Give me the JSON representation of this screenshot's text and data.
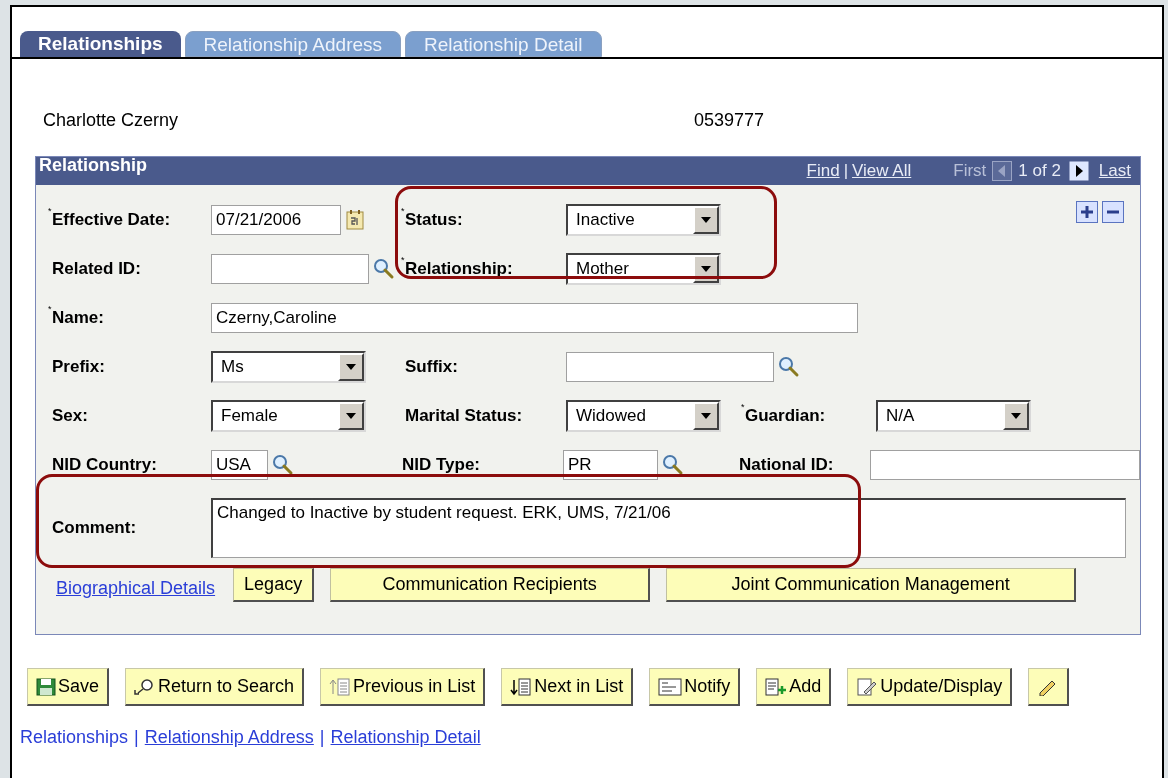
{
  "tabs": [
    {
      "label": "Relationships",
      "selected": true
    },
    {
      "label": "Relationship Address",
      "selected": false
    },
    {
      "label": "Relationship Detail",
      "selected": false
    }
  ],
  "required_mark": "*",
  "person": {
    "name": "Charlotte Czerny",
    "id": "0539777"
  },
  "panel": {
    "title": "Relationship",
    "find": "Find",
    "separator": "|",
    "view_all": "View All",
    "first": "First",
    "count": "1 of 2",
    "last": "Last",
    "first_disabled": true,
    "rows": [
      [
        {
          "label": "Effective Date:",
          "required": true,
          "kind": "date",
          "value": "07/21/2006"
        },
        {
          "label": "Status:",
          "required": true,
          "kind": "select",
          "value": "Inactive"
        }
      ],
      [
        {
          "label": "Related ID:",
          "required": false,
          "kind": "lookup"
        },
        {
          "label": "Relationship:",
          "required": true,
          "kind": "select",
          "value": "Mother"
        }
      ],
      [
        {
          "label": "Name:",
          "required": true,
          "kind": "text",
          "value": "Czerny,Caroline"
        }
      ],
      [
        {
          "label": "Prefix:",
          "required": false,
          "kind": "select",
          "value": "Ms"
        },
        {
          "label": "Suffix:",
          "required": false,
          "kind": "lookup"
        }
      ],
      [
        {
          "label": "Sex:",
          "required": false,
          "kind": "select",
          "value": "Female"
        },
        {
          "label": "Marital Status:",
          "required": false,
          "kind": "select",
          "value": "Widowed"
        },
        {
          "label": "Guardian:",
          "required": true,
          "kind": "select",
          "value": "N/A"
        }
      ],
      [
        {
          "label": "NID Country:",
          "required": false,
          "kind": "lookup",
          "value": "USA"
        },
        {
          "label": "NID Type:",
          "required": false,
          "kind": "lookup",
          "value": "PR"
        },
        {
          "label": "National ID:",
          "required": false,
          "kind": "text"
        }
      ],
      [
        {
          "label": "Comment:",
          "required": false,
          "kind": "textarea",
          "value": "Changed to Inactive by student request. ERK, UMS, 7/21/06"
        }
      ]
    ],
    "link": "Biographical Details",
    "buttons": [
      "Legacy",
      "Communication Recipients",
      "Joint Communication Management"
    ]
  },
  "toolbar": [
    {
      "kind": "labeled",
      "label": "Save"
    },
    {
      "kind": "labeled",
      "label": "Return to Search"
    },
    {
      "kind": "labeled",
      "label": "Previous in List"
    },
    {
      "kind": "labeled",
      "label": "Next in List"
    },
    {
      "kind": "labeled",
      "label": "Notify"
    },
    {
      "kind": "labeled",
      "label": "Add"
    },
    {
      "kind": "labeled",
      "label": "Update/Display"
    },
    {
      "kind": "icon"
    }
  ],
  "footer_links": [
    {
      "label": "Relationships",
      "selected": true
    },
    {
      "label": "Relationship Address",
      "selected": false
    },
    {
      "label": "Relationship Detail",
      "selected": false
    }
  ],
  "footer_separator": "|"
}
